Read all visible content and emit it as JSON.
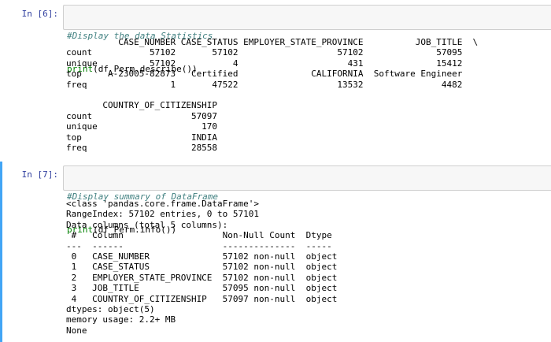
{
  "cell6": {
    "prompt": "In [6]:",
    "code": {
      "comment": "#Display the data Statistics",
      "print_kw": "print",
      "print_args": "(df_Perm.describe())"
    },
    "output_lines": [
      "          CASE_NUMBER CASE_STATUS EMPLOYER_STATE_PROVINCE          JOB_TITLE  \\",
      "count           57102       57102                   57102              57095",
      "unique          57102           4                     431              15412",
      "top     A-23005-82873   Certified              CALIFORNIA  Software Engineer",
      "freq                1       47522                   13532               4482",
      "",
      "       COUNTRY_OF_CITIZENSHIP",
      "count                   57097",
      "unique                    170",
      "top                     INDIA",
      "freq                    28558"
    ]
  },
  "cell7": {
    "prompt": "In [7]:",
    "code": {
      "comment": "#Display summary of DataFrame",
      "print_kw": "print",
      "print_args": "(df_Perm.info())"
    },
    "output_lines": [
      "<class 'pandas.core.frame.DataFrame'>",
      "RangeIndex: 57102 entries, 0 to 57101",
      "Data columns (total 5 columns):",
      " #   Column                   Non-Null Count  Dtype ",
      "---  ------                   --------------  ----- ",
      " 0   CASE_NUMBER              57102 non-null  object",
      " 1   CASE_STATUS              57102 non-null  object",
      " 2   EMPLOYER_STATE_PROVINCE  57102 non-null  object",
      " 3   JOB_TITLE                57095 non-null  object",
      " 4   COUNTRY_OF_CITIZENSHIP   57097 non-null  object",
      "dtypes: object(5)",
      "memory usage: 2.2+ MB",
      "None"
    ]
  },
  "colors": {
    "prompt": "#303f9f",
    "comment": "#408080",
    "builtin": "#008000",
    "selected_bar": "#42a5f5",
    "input_bg": "#f7f7f7"
  }
}
